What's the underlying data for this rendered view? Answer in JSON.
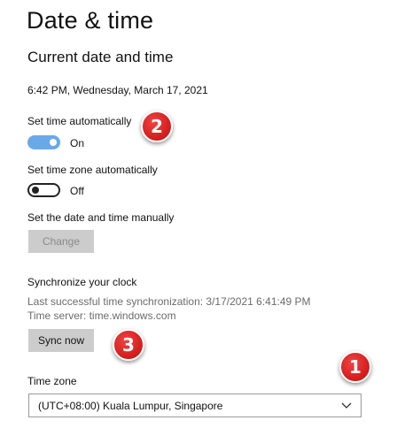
{
  "page": {
    "title": "Date & time"
  },
  "current": {
    "section_title": "Current date and time",
    "datetime": "6:42 PM, Wednesday, March 17, 2021"
  },
  "auto_time": {
    "label": "Set time automatically",
    "state": "On",
    "enabled": true
  },
  "auto_timezone": {
    "label": "Set time zone automatically",
    "state": "Off",
    "enabled": false
  },
  "manual": {
    "label": "Set the date and time manually",
    "button": "Change"
  },
  "sync": {
    "heading": "Synchronize your clock",
    "last_sync": "Last successful time synchronization: 3/17/2021 6:41:49 PM",
    "server": "Time server: time.windows.com",
    "button": "Sync now"
  },
  "timezone": {
    "label": "Time zone",
    "selected": "(UTC+08:00) Kuala Lumpur, Singapore"
  },
  "badges": [
    "1",
    "2",
    "3"
  ],
  "colors": {
    "toggle_on": "#6aa9e9",
    "badge": "#d72020",
    "button": "#cccccc"
  }
}
